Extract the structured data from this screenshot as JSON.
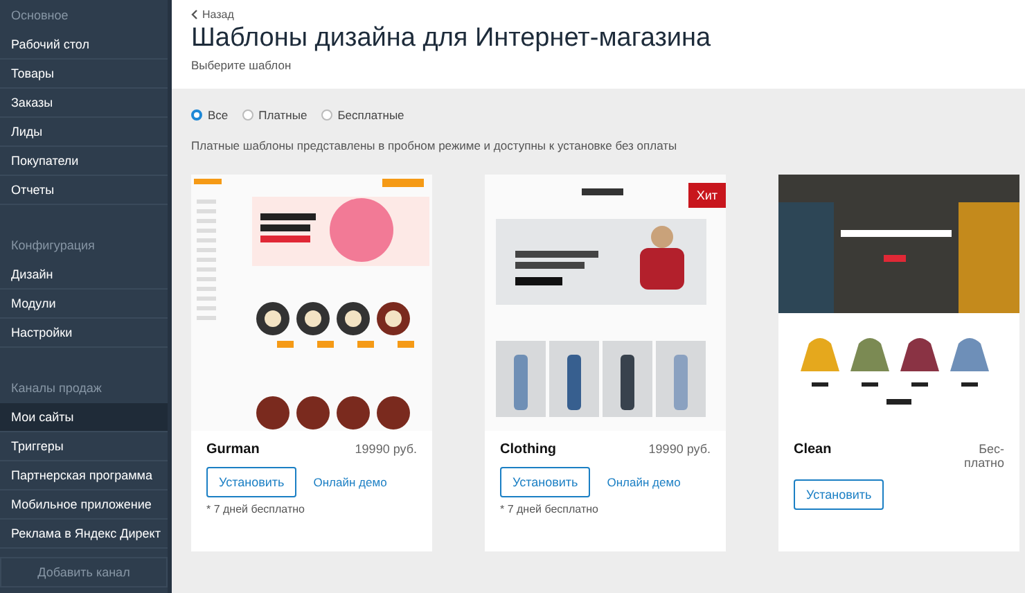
{
  "sidebar": {
    "sections": [
      {
        "title": "Основное",
        "items": [
          {
            "label": "Рабочий стол",
            "selected": false
          },
          {
            "label": "Товары",
            "selected": false
          },
          {
            "label": "Заказы",
            "selected": false
          },
          {
            "label": "Лиды",
            "selected": false
          },
          {
            "label": "Покупатели",
            "selected": false
          },
          {
            "label": "Отчеты",
            "selected": false
          }
        ]
      },
      {
        "title": "Конфигурация",
        "items": [
          {
            "label": "Дизайн",
            "selected": false
          },
          {
            "label": "Модули",
            "selected": false
          },
          {
            "label": "Настройки",
            "selected": false
          }
        ]
      },
      {
        "title": "Каналы продаж",
        "items": [
          {
            "label": "Мои сайты",
            "selected": true
          },
          {
            "label": "Триггеры",
            "selected": false
          },
          {
            "label": "Партнерская программа",
            "selected": false
          },
          {
            "label": "Мобильное приложение",
            "selected": false
          },
          {
            "label": "Реклама в Яндекс Директ",
            "selected": false
          }
        ]
      }
    ],
    "add_button": "Добавить канал"
  },
  "header": {
    "back": "Назад",
    "title": "Шаблоны дизайна для Интернет-магазина",
    "subtitle": "Выберите шаблон"
  },
  "filters": [
    {
      "label": "Все",
      "selected": true
    },
    {
      "label": "Платные",
      "selected": false
    },
    {
      "label": "Бесплатные",
      "selected": false
    }
  ],
  "note": "Платные шаблоны представлены в пробном режиме и доступны к установке без оплаты",
  "templates": [
    {
      "name": "Gurman",
      "price": "19990 руб.",
      "kind": "food",
      "install": "Установить",
      "demo": "Онлайн демо",
      "trial": "* 7 дней бесплатно"
    },
    {
      "name": "Clothing",
      "price": "19990 руб.",
      "kind": "fashion",
      "badge": "Хит",
      "install": "Установить",
      "demo": "Онлайн демо",
      "trial": "* 7 дней бесплатно"
    },
    {
      "name": "Clean",
      "price": "Бес-платно",
      "kind": "hoodies",
      "install": "Установить"
    }
  ]
}
